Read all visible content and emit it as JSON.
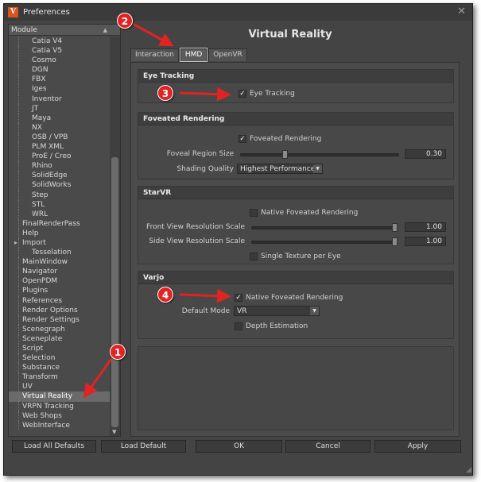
{
  "window": {
    "title": "Preferences",
    "app_icon_glyph": "V"
  },
  "module_panel": {
    "header": "Module",
    "items": [
      {
        "label": "Catia V4",
        "level": 2
      },
      {
        "label": "Catia V5",
        "level": 2
      },
      {
        "label": "Cosmo",
        "level": 2
      },
      {
        "label": "DGN",
        "level": 2
      },
      {
        "label": "FBX",
        "level": 2
      },
      {
        "label": "Iges",
        "level": 2
      },
      {
        "label": "Inventor",
        "level": 2
      },
      {
        "label": "JT",
        "level": 2
      },
      {
        "label": "Maya",
        "level": 2
      },
      {
        "label": "NX",
        "level": 2
      },
      {
        "label": "OSB / VPB",
        "level": 2
      },
      {
        "label": "PLM XML",
        "level": 2
      },
      {
        "label": "ProE / Creo",
        "level": 2
      },
      {
        "label": "Rhino",
        "level": 2
      },
      {
        "label": "SolidEdge",
        "level": 2
      },
      {
        "label": "SolidWorks",
        "level": 2
      },
      {
        "label": "Step",
        "level": 2
      },
      {
        "label": "STL",
        "level": 2
      },
      {
        "label": "WRL",
        "level": 2
      },
      {
        "label": "FinalRenderPass",
        "level": 1
      },
      {
        "label": "Help",
        "level": 1
      },
      {
        "label": "Import",
        "level": 1,
        "expander": true
      },
      {
        "label": "Tesselation",
        "level": 2
      },
      {
        "label": "MainWindow",
        "level": 1
      },
      {
        "label": "Navigator",
        "level": 1
      },
      {
        "label": "OpenPDM",
        "level": 1
      },
      {
        "label": "Plugins",
        "level": 1
      },
      {
        "label": "References",
        "level": 1
      },
      {
        "label": "Render Options",
        "level": 1
      },
      {
        "label": "Render Settings",
        "level": 1
      },
      {
        "label": "Scenegraph",
        "level": 1
      },
      {
        "label": "Sceneplate",
        "level": 1
      },
      {
        "label": "Script",
        "level": 1
      },
      {
        "label": "Selection",
        "level": 1
      },
      {
        "label": "Substance",
        "level": 1
      },
      {
        "label": "Transform",
        "level": 1
      },
      {
        "label": "UV",
        "level": 1
      },
      {
        "label": "Virtual Reality",
        "level": 1,
        "selected": true
      },
      {
        "label": "VRPN Tracking",
        "level": 1
      },
      {
        "label": "Web Shops",
        "level": 1
      },
      {
        "label": "WebInterface",
        "level": 1
      }
    ]
  },
  "page_title": "Virtual Reality",
  "tabs": [
    {
      "label": "Interaction",
      "active": false
    },
    {
      "label": "HMD",
      "active": true
    },
    {
      "label": "OpenVR",
      "active": false
    }
  ],
  "eye_tracking": {
    "header": "Eye Tracking",
    "checkbox_label": "Eye Tracking",
    "checked": true
  },
  "foveated": {
    "header": "Foveated Rendering",
    "checkbox_label": "Foveated Rendering",
    "checked": true,
    "foveal_label": "Foveal Region Size",
    "foveal_value": "0.30",
    "foveal_fraction": 0.27,
    "shading_label": "Shading Quality",
    "shading_value": "Highest Performance"
  },
  "starvr": {
    "header": "StarVR",
    "native_label": "Native Foveated Rendering",
    "native_checked": false,
    "front_label": "Front View Resolution Scale",
    "front_value": "1.00",
    "side_label": "Side View Resolution Scale",
    "side_value": "1.00",
    "single_label": "Single Texture per Eye",
    "single_checked": false
  },
  "varjo": {
    "header": "Varjo",
    "native_label": "Native Foveated Rendering",
    "native_checked": true,
    "mode_label": "Default Mode",
    "mode_value": "VR",
    "depth_label": "Depth Estimation",
    "depth_checked": false
  },
  "buttons": {
    "load_all": "Load All Defaults",
    "load_default": "Load Default",
    "ok": "OK",
    "cancel": "Cancel",
    "apply": "Apply"
  },
  "callouts": [
    "1",
    "2",
    "3",
    "4"
  ],
  "colors": {
    "callout_red": "#e02323",
    "window_bg": "#444444",
    "selected_row": "#6a6a6a"
  },
  "icons": {
    "check": "✓",
    "close": "✕",
    "dropdown": "▼",
    "scroll_up": "▲",
    "scroll_down": "▼",
    "grip": "◢"
  }
}
